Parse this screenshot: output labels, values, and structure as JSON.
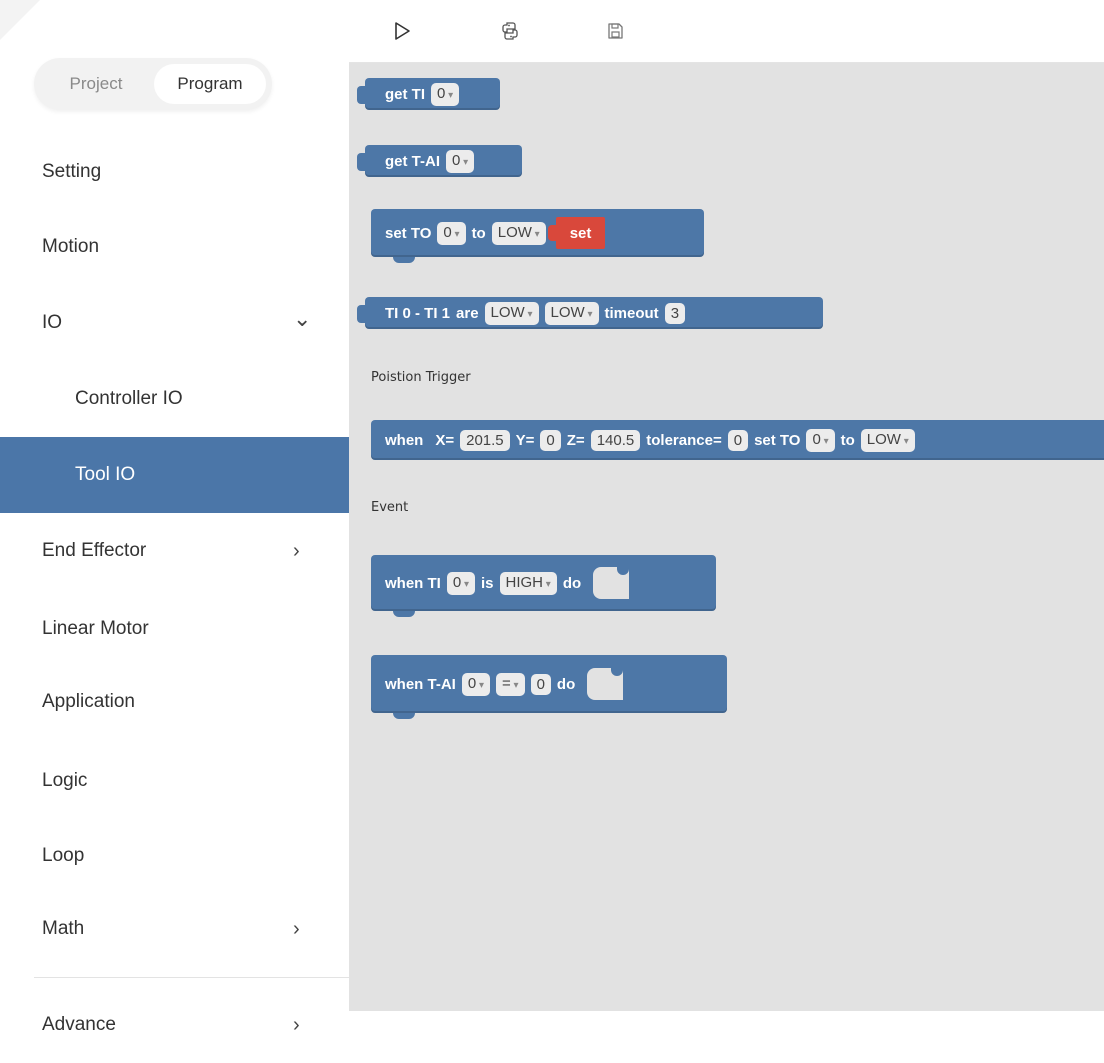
{
  "sidebar": {
    "toggle": {
      "project": "Project",
      "program": "Program"
    },
    "items": [
      {
        "label": "Setting"
      },
      {
        "label": "Motion"
      },
      {
        "label": "IO",
        "chevron": "⌄"
      },
      {
        "label": "Controller IO"
      },
      {
        "label": "Tool IO"
      },
      {
        "label": "End Effector",
        "chevron": "›"
      },
      {
        "label": "Linear Motor"
      },
      {
        "label": "Application"
      },
      {
        "label": "Logic"
      },
      {
        "label": "Loop"
      },
      {
        "label": "Math",
        "chevron": "›"
      },
      {
        "label": "Advance",
        "chevron": "›"
      }
    ],
    "active_item": "Tool IO"
  },
  "toolbar": {
    "run_icon": "play-icon",
    "code_icon": "python-icon",
    "save_icon": "save-icon"
  },
  "workspace": {
    "blocks": {
      "get_ti": {
        "label": "get TI",
        "port": "0"
      },
      "get_tai": {
        "label": "get T-AI",
        "port": "0"
      },
      "set_to": {
        "label": "set TO",
        "port": "0",
        "to": "to",
        "level": "LOW",
        "set": "set"
      },
      "ti_pair": {
        "label": "TI 0 - TI 1",
        "are": "are",
        "level1": "LOW",
        "level2": "LOW",
        "timeout_label": "timeout",
        "timeout": "3"
      },
      "position_trigger": {
        "when": "when",
        "x_label": "X=",
        "x": "201.5",
        "y_label": "Y=",
        "y": "0",
        "z_label": "Z=",
        "z": "140.5",
        "tol_label": "tolerance=",
        "tolerance": "0",
        "set_to": "set TO",
        "port": "0",
        "to": "to",
        "level": "LOW"
      },
      "when_ti": {
        "label": "when TI",
        "port": "0",
        "is": "is",
        "level": "HIGH",
        "do": "do"
      },
      "when_tai": {
        "label": "when T-AI",
        "port": "0",
        "op": "=",
        "value": "0",
        "do": "do"
      }
    },
    "section_position": "Poistion Trigger",
    "section_event": "Event"
  },
  "colors": {
    "accent": "#4b76a8",
    "block": "#4d77a7",
    "set_block": "#d9483b",
    "workspace": "#e2e2e2"
  }
}
